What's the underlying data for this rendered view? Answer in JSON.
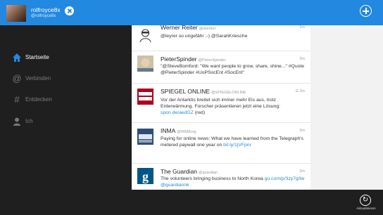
{
  "header": {
    "username": "rolfroyce8x",
    "handle": "@rolfroyce8x"
  },
  "nav": [
    {
      "label": "Startseite",
      "icon": "home-icon"
    },
    {
      "label": "Verbinden",
      "icon": "at-icon"
    },
    {
      "label": "Entdecken",
      "icon": "hashtag-icon"
    },
    {
      "label": "Ich",
      "icon": "person-icon"
    }
  ],
  "tweets": [
    {
      "name": "Werner Reiter",
      "handle": "@wierdur",
      "time": "1m",
      "text": "@leyrer so ungefähr ;-) @SarahKriesche"
    },
    {
      "name": "PieterSpinder",
      "handle": "@PieterSpinder",
      "time": "2m",
      "text": "\"@SteveBomford: \"We want people to grow, share, shine...\" #Quote @PieterSpinder #UoPSocEnt #SocEnt\""
    },
    {
      "name": "SPIEGEL ONLINE",
      "handle": "@SPIEGELONLINE",
      "time": "2m",
      "text": "Vor der Antarktis breitet sich immer mehr Eis aus, trotz Erderwärmung. Forscher präsentieren jetzt eine Lösung: ",
      "link": "spon.de/aedGZ",
      "suffix": " (red)"
    },
    {
      "name": "INMA",
      "handle": "@INMAorg",
      "time": "2m",
      "text": "Paying for online news: What we have learned from the Telegraph's metered paywall one year on ",
      "link": "bit.ly/1jVFpnr"
    },
    {
      "name": "The Guardian",
      "handle": "@guardian",
      "time": "2m",
      "text": "The volunteers bringing business to North Korea ",
      "link": "gu.com/p/3zy7g/tw",
      "suffix": " @guardiannk"
    }
  ],
  "bottombar": {
    "refresh_label": "Aktualisieren"
  },
  "colors": {
    "accent": "#2288e0",
    "sidebar": "#1f1f1f"
  }
}
